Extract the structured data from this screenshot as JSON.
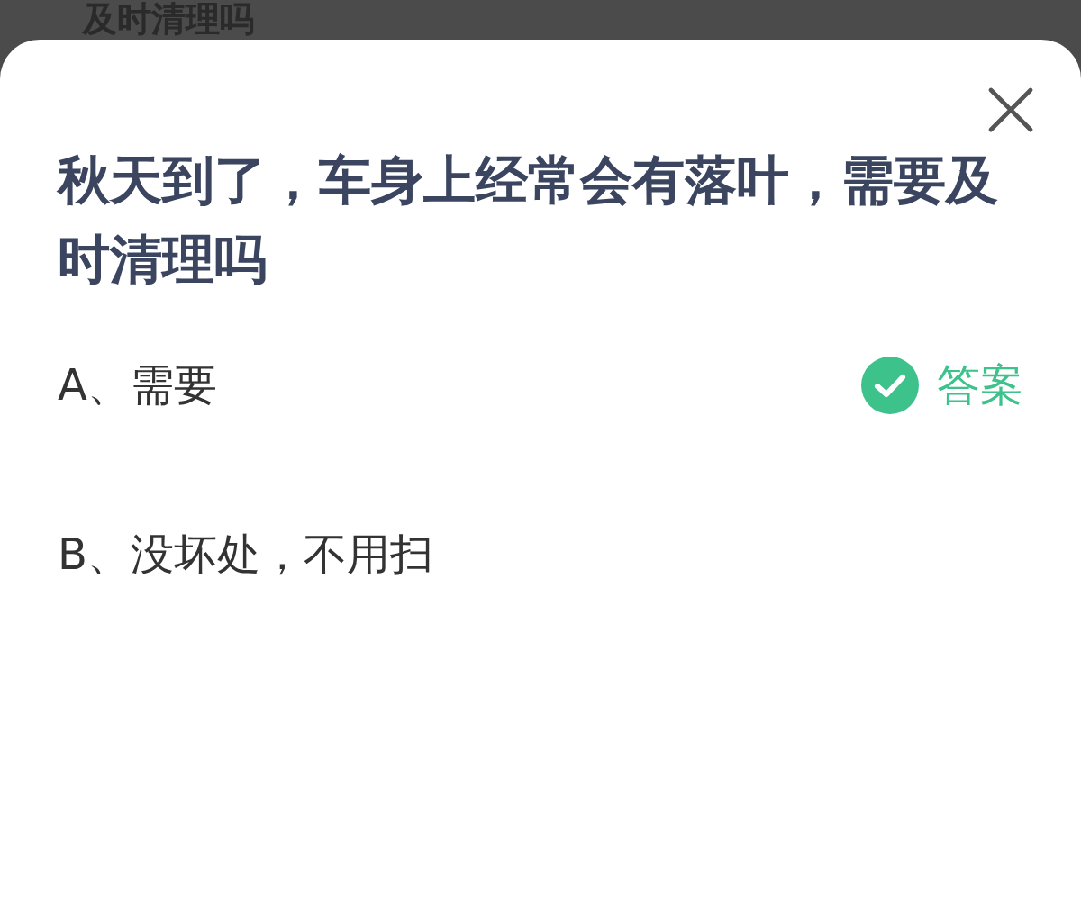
{
  "background_text": "及时清理吗",
  "question": "秋天到了，车身上经常会有落叶，需要及时清理吗",
  "options": [
    {
      "text": "A、需要",
      "is_answer": true,
      "badge": "答案"
    },
    {
      "text": "B、没坏处，不用扫",
      "is_answer": false
    }
  ]
}
